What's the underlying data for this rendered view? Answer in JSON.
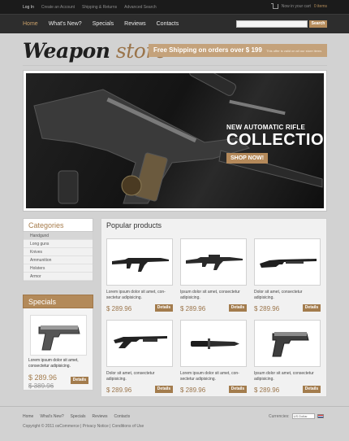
{
  "topbar": {
    "links": [
      "Log In",
      "Create an Account",
      "Shipping & Returns",
      "Advanced Search"
    ],
    "cart_text": "Now in your cart",
    "cart_items": "0 items"
  },
  "nav": {
    "items": [
      "Home",
      "What's New?",
      "Specials",
      "Reviews",
      "Contacts"
    ],
    "search_placeholder": "",
    "search_button": "Search"
  },
  "logo": {
    "part1": "Weapon",
    "part2": " store"
  },
  "shipping": {
    "text": "Free Shipping on orders over $ 199",
    "note": "This offer is valid on all our store items"
  },
  "banner": {
    "line1": "NEW AUTOMATIC RIFLE",
    "line2": "COLLECTION",
    "button": "SHOP NOW!"
  },
  "categories": {
    "title": "Categories",
    "items": [
      "Handgund",
      "Long guns",
      "Knives",
      "Ammunition",
      "Holsters",
      "Armor"
    ]
  },
  "specials": {
    "title": "Specials",
    "text": "Lorem ipsum dolor sit amet, consectetur adipisicing.",
    "price": "$ 289.96",
    "old_price": "$ 389.96",
    "button": "Details"
  },
  "products": {
    "title": "Popular products",
    "items": [
      {
        "desc": "Lorem ipsum dolor sit amet, con-sectetur adipisicing.",
        "price": "$ 289.96",
        "button": "Details",
        "icon": "assault-rifle"
      },
      {
        "desc": "Ipsum dolor sit amet, consectetur adipisicing.",
        "price": "$ 289.96",
        "button": "Details",
        "icon": "automatic-rifle"
      },
      {
        "desc": "Dolor sit amet, consectetur adipisicing.",
        "price": "$ 289.96",
        "button": "Details",
        "icon": "shotgun"
      },
      {
        "desc": "Dolor sit amet, consectetur adipisicing.",
        "price": "$ 289.96",
        "button": "Details",
        "icon": "pump-shotgun"
      },
      {
        "desc": "Lorem ipsum dolor sit amet, con-sectetur adipisicing.",
        "price": "$ 289.96",
        "button": "Details",
        "icon": "combat-knife"
      },
      {
        "desc": "Ipsum dolor sit amet, consectetur adipisicing.",
        "price": "$ 289.96",
        "button": "Details",
        "icon": "pistol"
      }
    ]
  },
  "footer": {
    "links": [
      "Home",
      "What's New?",
      "Specials",
      "Reviews",
      "Contacts"
    ],
    "copyright": "Copyright © 2011 osCommerce   |   Privacy Notice   |   Conditions of Use",
    "currencies_label": "Currencies:",
    "currency_selected": "US Dollar"
  }
}
